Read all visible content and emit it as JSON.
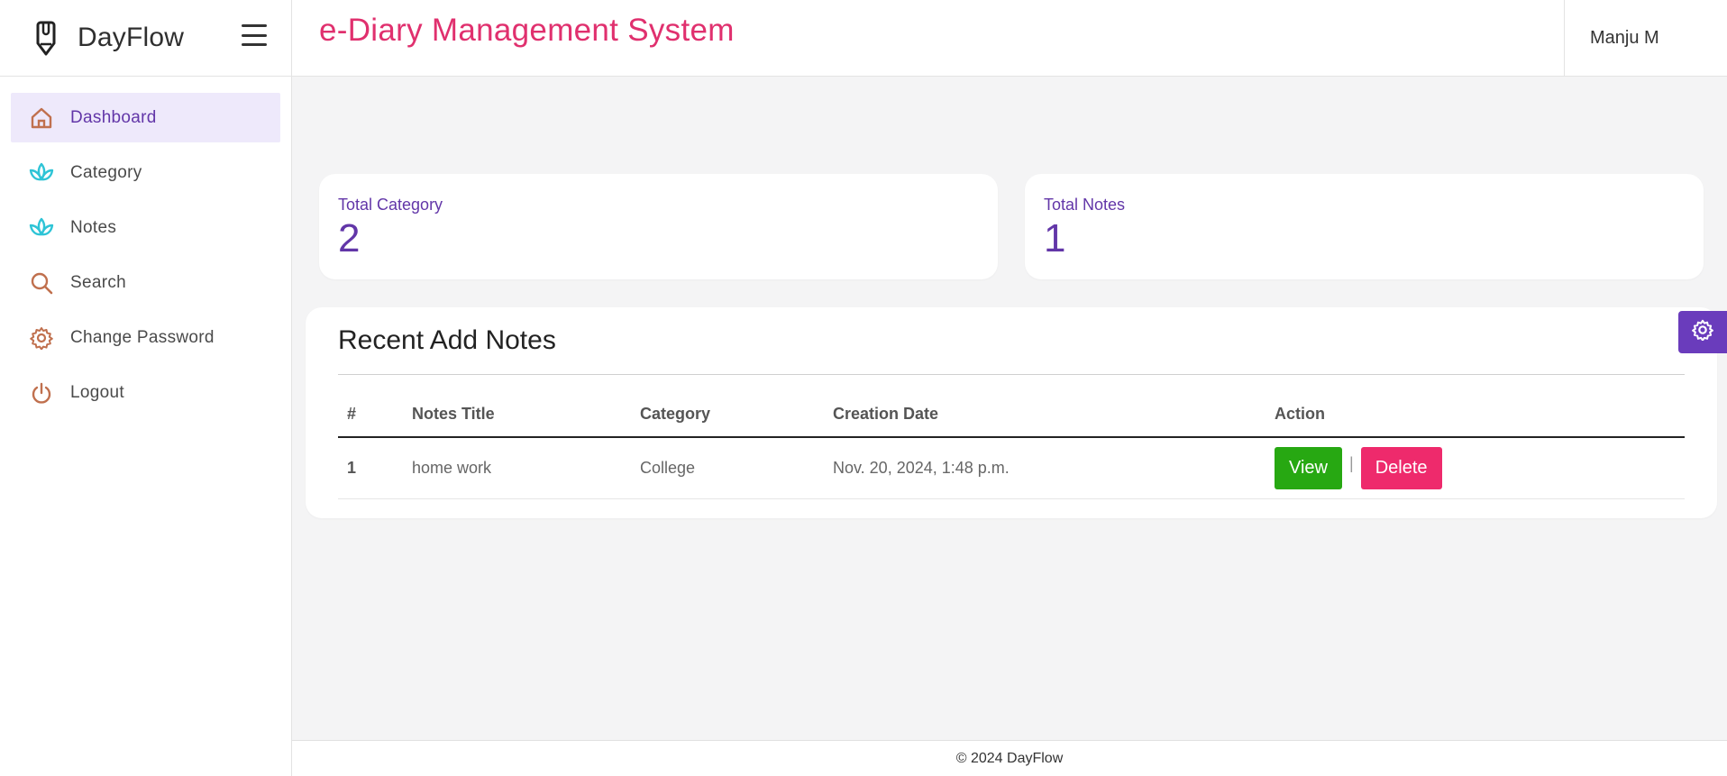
{
  "brand": {
    "name": "DayFlow",
    "logo_icon": "pen-icon"
  },
  "header": {
    "title": "e-Diary Management System",
    "user": "Manju M"
  },
  "sidebar": {
    "items": [
      {
        "label": "Dashboard",
        "icon": "home-icon",
        "active": true
      },
      {
        "label": "Category",
        "icon": "lotus-icon"
      },
      {
        "label": "Notes",
        "icon": "lotus-icon"
      },
      {
        "label": "Search",
        "icon": "search-icon"
      },
      {
        "label": "Change Password",
        "icon": "gear-icon"
      },
      {
        "label": "Logout",
        "icon": "power-icon"
      }
    ]
  },
  "stats": [
    {
      "label": "Total Category",
      "value": "2"
    },
    {
      "label": "Total Notes",
      "value": "1"
    }
  ],
  "recent": {
    "title": "Recent Add Notes",
    "columns": [
      "#",
      "Notes Title",
      "Category",
      "Creation Date",
      "Action"
    ],
    "rows": [
      {
        "num": "1",
        "title": "home work",
        "category": "College",
        "date": "Nov. 20, 2024, 1:48 p.m."
      }
    ],
    "view_label": "View",
    "separator": "|",
    "delete_label": "Delete"
  },
  "footer": {
    "text": "© 2024 DayFlow"
  },
  "colors": {
    "accent": "#6236a8",
    "title": "#e0306e",
    "view": "#27a812",
    "delete": "#ee2a6c",
    "icon_orange": "#c0704e",
    "icon_teal": "#2ec4d6"
  }
}
